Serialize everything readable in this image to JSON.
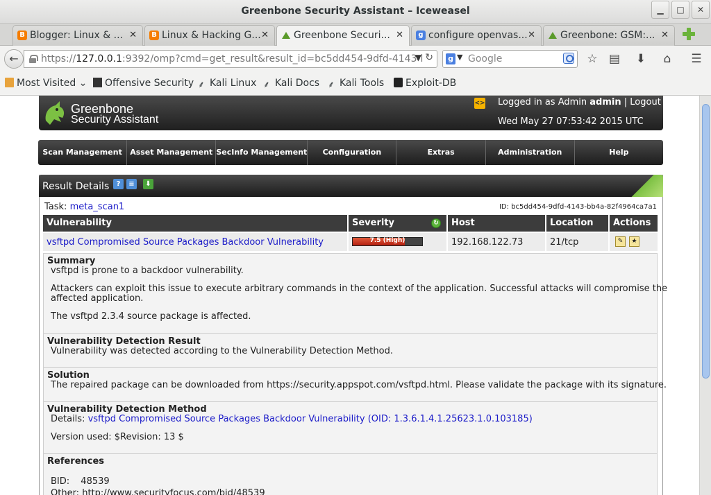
{
  "window": {
    "title": "Greenbone Security Assistant – Iceweasel"
  },
  "tabs": [
    {
      "label": "Blogger: Linux & ...",
      "color": "#f57d00",
      "glyph": "B"
    },
    {
      "label": "Linux & Hacking G...",
      "color": "#f57d00",
      "glyph": "B"
    },
    {
      "label": "Greenbone Securi...",
      "color": "#5a9a2a",
      "glyph": "",
      "active": true
    },
    {
      "label": "configure openvas...",
      "color": "#4a7fe0",
      "glyph": "g"
    },
    {
      "label": "Greenbone: GSM:...",
      "color": "#5a9a2a",
      "glyph": ""
    }
  ],
  "navbar": {
    "url_prefix": "https://",
    "url_host": "127.0.0.1",
    "url_rest": ":9392/omp?cmd=get_result&result_id=bc5dd454-9dfd-4143-l",
    "search_placeholder": "Google"
  },
  "bookmarks": [
    {
      "label": "Most Visited",
      "icon": "folder-icon"
    },
    {
      "label": "Offensive Security",
      "icon": "offsec-icon"
    },
    {
      "label": "Kali Linux",
      "icon": "kali-icon"
    },
    {
      "label": "Kali Docs",
      "icon": "kali-icon"
    },
    {
      "label": "Kali Tools",
      "icon": "kali-icon"
    },
    {
      "label": "Exploit-DB",
      "icon": "exploitdb-icon"
    }
  ],
  "gsa": {
    "logo_line1": "Greenbone",
    "logo_line2": "Security Assistant",
    "logged_in_prefix": "Logged in as Admin",
    "user": "admin",
    "separator": "|",
    "logout": "Logout",
    "datetime": "Wed May 27 07:53:42 2015 UTC",
    "menu": [
      "Scan Management",
      "Asset Management",
      "SecInfo Management",
      "Configuration",
      "Extras",
      "Administration",
      "Help"
    ]
  },
  "result": {
    "panel_title": "Result Details",
    "task_label": "Task:",
    "task_name": "meta_scan1",
    "id_label": "ID:",
    "id_value": "bc5dd454-9dfd-4143-bb4a-82f4964ca7a1",
    "columns": {
      "vulnerability": "Vulnerability",
      "severity": "Severity",
      "host": "Host",
      "location": "Location",
      "actions": "Actions"
    },
    "row": {
      "vulnerability": "vsftpd Compromised Source Packages Backdoor Vulnerability",
      "severity_label": "7.5 (High)",
      "severity_value": 7.5,
      "host": "192.168.122.73",
      "location": "21/tcp"
    },
    "summary": {
      "heading": "Summary",
      "line1": "vsftpd is prone to a backdoor vulnerability.",
      "line2": "Attackers can exploit this issue to execute arbitrary commands in the context of the application. Successful attacks will compromise the",
      "line3": "affected application.",
      "line4": "The vsftpd 2.3.4 source package is affected."
    },
    "detection_result": {
      "heading": "Vulnerability Detection Result",
      "text": "Vulnerability was detected according to the Vulnerability Detection Method."
    },
    "solution": {
      "heading": "Solution",
      "text": "The repaired package can be downloaded from https://security.appspot.com/vsftpd.html. Please validate the package with its signature."
    },
    "detection_method": {
      "heading": "Vulnerability Detection Method",
      "details_label": "Details:",
      "details_link": "vsftpd Compromised Source Packages Backdoor Vulnerability (OID: 1.3.6.1.4.1.25623.1.0.103185)",
      "version_label": "Version used:",
      "version_value": "$Revision: 13 $"
    },
    "references": {
      "heading": "References",
      "bid_label": "BID:",
      "bid_value": "48539",
      "other_label": "Other:",
      "other_value": "http://www.securityfocus.com/bid/48539"
    }
  }
}
